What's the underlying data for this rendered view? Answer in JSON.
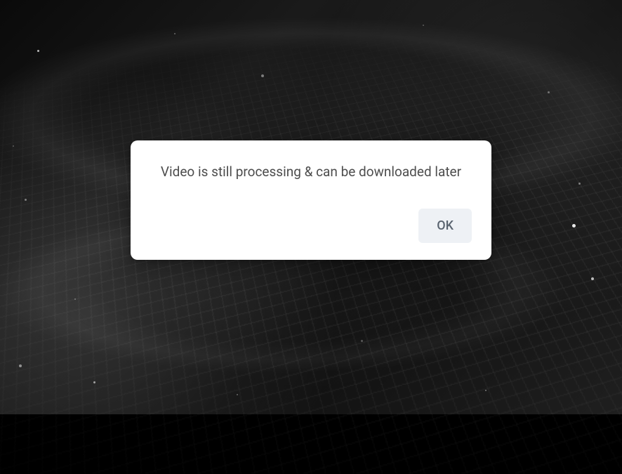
{
  "dialog": {
    "message": "Video is still processing & can be downloaded later",
    "ok_label": "OK"
  }
}
